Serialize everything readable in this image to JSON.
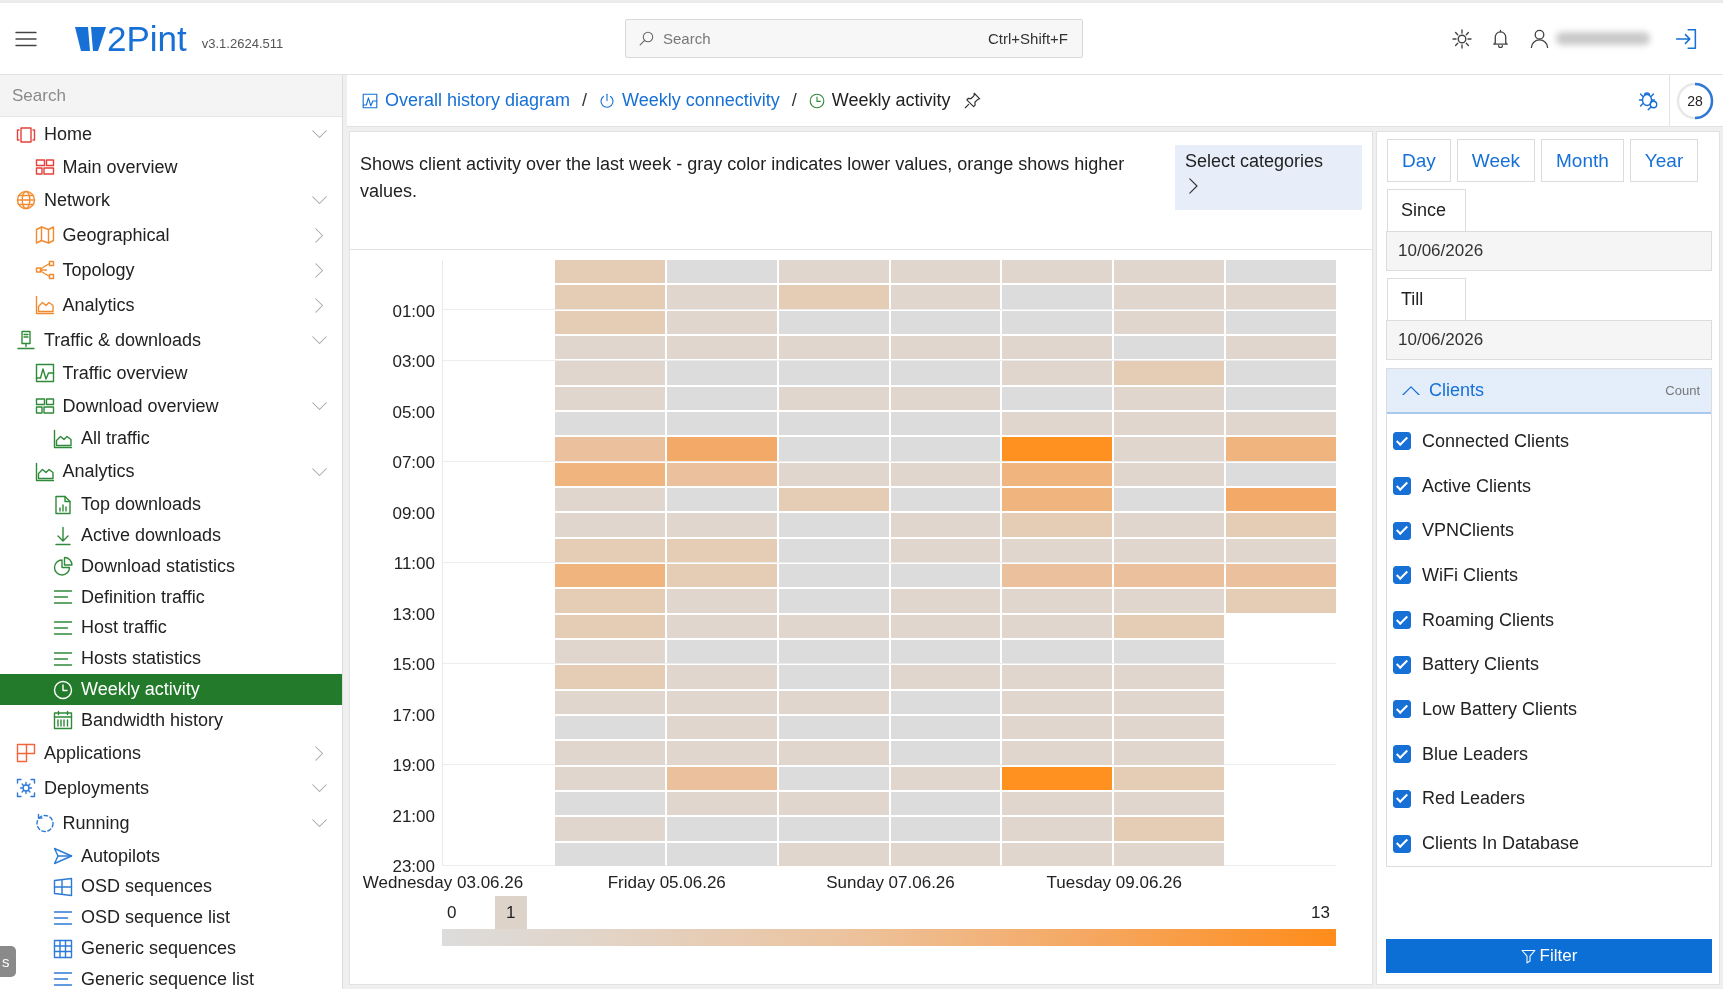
{
  "header": {
    "logo": "2Pint",
    "version": "v3.1.2624.511",
    "search": {
      "placeholder": "Search",
      "shortcut": "Ctrl+Shift+F"
    }
  },
  "sidebar": {
    "search": {
      "placeholder": "Search"
    },
    "items": [
      {
        "label": "Home",
        "expanded": true,
        "selected": false,
        "children": [
          {
            "label": "Main overview",
            "selected": false
          }
        ]
      },
      {
        "label": "Network",
        "expanded": true,
        "selected": false,
        "children": [
          {
            "label": "Geographical",
            "expanded": false,
            "selected": false
          },
          {
            "label": "Topology",
            "expanded": false,
            "selected": false
          },
          {
            "label": "Analytics",
            "expanded": false,
            "selected": false
          }
        ]
      },
      {
        "label": "Traffic & downloads",
        "expanded": true,
        "selected": false,
        "children": [
          {
            "label": "Traffic overview",
            "selected": false
          },
          {
            "label": "Download overview",
            "expanded": true,
            "selected": false,
            "children": [
              {
                "label": "All traffic",
                "selected": false
              }
            ]
          },
          {
            "label": "Analytics",
            "expanded": true,
            "selected": false,
            "children": [
              {
                "label": "Top downloads",
                "selected": false
              },
              {
                "label": "Active downloads",
                "selected": false
              },
              {
                "label": "Download statistics",
                "selected": false
              },
              {
                "label": "Definition traffic",
                "selected": false
              },
              {
                "label": "Host traffic",
                "selected": false
              },
              {
                "label": "Hosts statistics",
                "selected": false
              },
              {
                "label": "Weekly activity",
                "selected": true
              },
              {
                "label": "Bandwidth history",
                "selected": false
              }
            ]
          }
        ]
      },
      {
        "label": "Applications",
        "expanded": false,
        "selected": false
      },
      {
        "label": "Deployments",
        "expanded": true,
        "selected": false,
        "children": [
          {
            "label": "Running",
            "expanded": true,
            "selected": false,
            "children": [
              {
                "label": "Autopilots",
                "selected": false
              },
              {
                "label": "OSD sequences",
                "selected": false
              },
              {
                "label": "OSD sequence list",
                "selected": false
              },
              {
                "label": "Generic sequences",
                "selected": false
              },
              {
                "label": "Generic sequence list",
                "selected": false
              }
            ]
          }
        ]
      }
    ]
  },
  "side_tab": {
    "label": "s"
  },
  "breadcrumb": {
    "items": [
      {
        "label": "Overall history diagram",
        "current": false,
        "separator": "/"
      },
      {
        "label": "Weekly connectivity",
        "current": false,
        "separator": "/"
      },
      {
        "label": "Weekly activity",
        "current": true
      }
    ]
  },
  "refresh_timer": {
    "label": "28",
    "level": 0.5
  },
  "description": "Shows client activity over the last week - gray color indicates lower values, orange shows higher values.",
  "select_categories": {
    "label": "Select categories"
  },
  "heatmap": {
    "y_labels": [
      "01:00",
      "03:00",
      "05:00",
      "07:00",
      "09:00",
      "11:00",
      "13:00",
      "15:00",
      "17:00",
      "19:00",
      "21:00",
      "23:00"
    ],
    "columns": [
      {
        "label": "Wednesday 03.06.26"
      },
      {
        "cells": [
          {
            "color": "#e5ccb5"
          },
          {
            "color": "#e5ccb5"
          },
          {
            "color": "#e5ccb5"
          },
          {
            "color": "#e0d6cd"
          },
          {
            "color": "#e0d6cd"
          },
          {
            "color": "#e0d6cd"
          },
          {
            "color": "#dcdcdc"
          },
          {
            "color": "#eac19c"
          },
          {
            "color": "#f0b47e"
          },
          {
            "color": "#e0d6cd"
          },
          {
            "color": "#e0d6cd"
          },
          {
            "color": "#e5ccb5"
          },
          {
            "color": "#f0b47e"
          },
          {
            "color": "#e5ccb5"
          },
          {
            "color": "#e5ccb5"
          },
          {
            "color": "#e0d6cd"
          },
          {
            "color": "#e5ccb5"
          },
          {
            "color": "#e0d6cd"
          },
          {
            "color": "#dcdcdc"
          },
          {
            "color": "#e0d6cd"
          },
          {
            "color": "#e0d6cd"
          },
          {
            "color": "#dcdcdc"
          },
          {
            "color": "#e0d6cd"
          },
          {
            "color": "#dcdcdc"
          }
        ]
      },
      {
        "label": "Friday 05.06.26",
        "cells": [
          {
            "color": "#dcdcdc"
          },
          {
            "color": "#e0d6cd"
          },
          {
            "color": "#e0d6cd"
          },
          {
            "color": "#e0d6cd"
          },
          {
            "color": "#dcdcdc"
          },
          {
            "color": "#dcdcdc"
          },
          {
            "color": "#dcdcdc"
          },
          {
            "color": "#f3aa68"
          },
          {
            "color": "#eac19c"
          },
          {
            "color": "#dcdcdc"
          },
          {
            "color": "#e0d6cd"
          },
          {
            "color": "#e5ccb5"
          },
          {
            "color": "#e5ccb5"
          },
          {
            "color": "#e0d6cd"
          },
          {
            "color": "#e0d6cd"
          },
          {
            "color": "#dcdcdc"
          },
          {
            "color": "#e0d6cd"
          },
          {
            "color": "#e0d6cd"
          },
          {
            "color": "#e0d6cd"
          },
          {
            "color": "#e0d6cd"
          },
          {
            "color": "#eac19c"
          },
          {
            "color": "#e0d6cd"
          },
          {
            "color": "#dcdcdc"
          },
          {
            "color": "#dcdcdc"
          }
        ]
      },
      {
        "cells": [
          {
            "color": "#e0d6cd"
          },
          {
            "color": "#e5ccb5"
          },
          {
            "color": "#dcdcdc"
          },
          {
            "color": "#e0d6cd"
          },
          {
            "color": "#dcdcdc"
          },
          {
            "color": "#e0d6cd"
          },
          {
            "color": "#dcdcdc"
          },
          {
            "color": "#dcdcdc"
          },
          {
            "color": "#e0d6cd"
          },
          {
            "color": "#e5ccb5"
          },
          {
            "color": "#dcdcdc"
          },
          {
            "color": "#dcdcdc"
          },
          {
            "color": "#dcdcdc"
          },
          {
            "color": "#dcdcdc"
          },
          {
            "color": "#e0d6cd"
          },
          {
            "color": "#dcdcdc"
          },
          {
            "color": "#dcdcdc"
          },
          {
            "color": "#e0d6cd"
          },
          {
            "color": "#dcdcdc"
          },
          {
            "color": "#e0d6cd"
          },
          {
            "color": "#dcdcdc"
          },
          {
            "color": "#e0d6cd"
          },
          {
            "color": "#dcdcdc"
          },
          {
            "color": "#e0d6cd"
          }
        ]
      },
      {
        "label": "Sunday 07.06.26",
        "cells": [
          {
            "color": "#e0d6cd"
          },
          {
            "color": "#e0d6cd"
          },
          {
            "color": "#dcdcdc"
          },
          {
            "color": "#e0d6cd"
          },
          {
            "color": "#dcdcdc"
          },
          {
            "color": "#e0d6cd"
          },
          {
            "color": "#dcdcdc"
          },
          {
            "color": "#dcdcdc"
          },
          {
            "color": "#e0d6cd"
          },
          {
            "color": "#dcdcdc"
          },
          {
            "color": "#e0d6cd"
          },
          {
            "color": "#e0d6cd"
          },
          {
            "color": "#dcdcdc"
          },
          {
            "color": "#e0d6cd"
          },
          {
            "color": "#e0d6cd"
          },
          {
            "color": "#dcdcdc"
          },
          {
            "color": "#e0d6cd"
          },
          {
            "color": "#dcdcdc"
          },
          {
            "color": "#dcdcdc"
          },
          {
            "color": "#dcdcdc"
          },
          {
            "color": "#e0d6cd"
          },
          {
            "color": "#dcdcdc"
          },
          {
            "color": "#dcdcdc"
          },
          {
            "color": "#e0d6cd"
          }
        ]
      },
      {
        "cells": [
          {
            "color": "#e0d6cd"
          },
          {
            "color": "#dcdcdc"
          },
          {
            "color": "#dcdcdc"
          },
          {
            "color": "#e0d6cd"
          },
          {
            "color": "#e0d6cd"
          },
          {
            "color": "#dcdcdc"
          },
          {
            "color": "#e0d6cd"
          },
          {
            "color": "#fe911f"
          },
          {
            "color": "#f0b47e"
          },
          {
            "color": "#f0b47e"
          },
          {
            "color": "#e5ccb5"
          },
          {
            "color": "#e0d6cd"
          },
          {
            "color": "#eac19c"
          },
          {
            "color": "#e0d6cd"
          },
          {
            "color": "#e0d6cd"
          },
          {
            "color": "#dcdcdc"
          },
          {
            "color": "#e0d6cd"
          },
          {
            "color": "#e0d6cd"
          },
          {
            "color": "#e0d6cd"
          },
          {
            "color": "#e0d6cd"
          },
          {
            "color": "#fe911f"
          },
          {
            "color": "#e0d6cd"
          },
          {
            "color": "#e0d6cd"
          },
          {
            "color": "#e0d6cd"
          }
        ]
      },
      {
        "label": "Tuesday 09.06.26",
        "cells": [
          {
            "color": "#e0d6cd"
          },
          {
            "color": "#e0d6cd"
          },
          {
            "color": "#e0d6cd"
          },
          {
            "color": "#dcdcdc"
          },
          {
            "color": "#e5ccb5"
          },
          {
            "color": "#e0d6cd"
          },
          {
            "color": "#e0d6cd"
          },
          {
            "color": "#e0d6cd"
          },
          {
            "color": "#e0d6cd"
          },
          {
            "color": "#dcdcdc"
          },
          {
            "color": "#e0d6cd"
          },
          {
            "color": "#e0d6cd"
          },
          {
            "color": "#eac19c"
          },
          {
            "color": "#e0d6cd"
          },
          {
            "color": "#e5ccb5"
          },
          {
            "color": "#dcdcdc"
          },
          {
            "color": "#e0d6cd"
          },
          {
            "color": "#e0d6cd"
          },
          {
            "color": "#e0d6cd"
          },
          {
            "color": "#e0d6cd"
          },
          {
            "color": "#e5ccb5"
          },
          {
            "color": "#e0d6cd"
          },
          {
            "color": "#e5ccb5"
          },
          {
            "color": "#e0d6cd"
          }
        ]
      },
      {
        "cells": [
          {
            "color": "#dcdcdc"
          },
          {
            "color": "#e0d6cd"
          },
          {
            "color": "#dcdcdc"
          },
          {
            "color": "#e0d6cd"
          },
          {
            "color": "#dcdcdc"
          },
          {
            "color": "#dcdcdc"
          },
          {
            "color": "#e0d6cd"
          },
          {
            "color": "#f0b47e"
          },
          {
            "color": "#dcdcdc"
          },
          {
            "color": "#f3aa68"
          },
          {
            "color": "#e5ccb5"
          },
          {
            "color": "#e0d6cd"
          },
          {
            "color": "#eac19c"
          },
          {
            "color": "#e5ccb5"
          }
        ]
      }
    ],
    "legend": {
      "min": "0",
      "max": "13",
      "marker": {
        "label": "1",
        "level": 0.077
      }
    }
  },
  "filters": {
    "ranges": [
      {
        "label": "Day",
        "selected": false
      },
      {
        "label": "Week",
        "selected": false
      },
      {
        "label": "Month",
        "selected": false
      },
      {
        "label": "Year",
        "selected": false
      }
    ],
    "since": {
      "label": "Since",
      "value": "10/06/2026"
    },
    "till": {
      "label": "Till",
      "value": "10/06/2026"
    },
    "clients": {
      "title": "Clients",
      "column": "Count",
      "expanded": true,
      "items": [
        {
          "label": "Connected Clients",
          "checked": true
        },
        {
          "label": "Active Clients",
          "checked": true
        },
        {
          "label": "VPNClients",
          "checked": true
        },
        {
          "label": "WiFi Clients",
          "checked": true
        },
        {
          "label": "Roaming Clients",
          "checked": true
        },
        {
          "label": "Battery Clients",
          "checked": true
        },
        {
          "label": "Low Battery Clients",
          "checked": true
        },
        {
          "label": "Blue Leaders",
          "checked": true
        },
        {
          "label": "Red Leaders",
          "checked": true
        },
        {
          "label": "Clients In Database",
          "checked": true
        }
      ]
    },
    "button": "Filter"
  }
}
